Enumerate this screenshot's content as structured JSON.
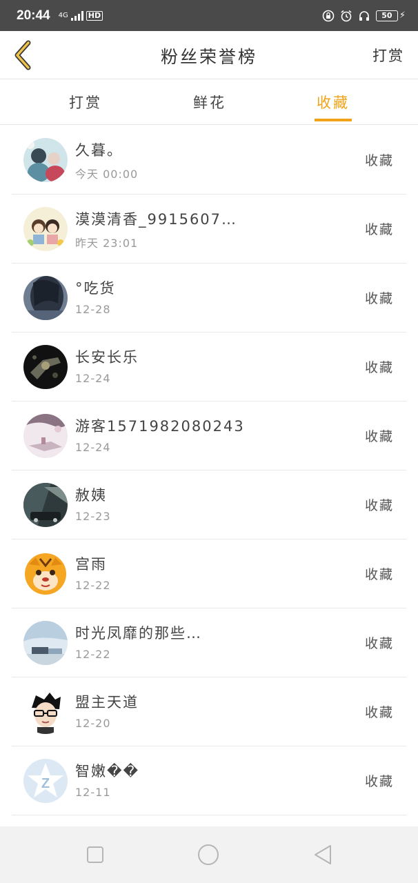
{
  "status_bar": {
    "time": "20:44",
    "network": "4G",
    "hd": "HD",
    "battery": "50",
    "icons": [
      "lock-rotation-icon",
      "alarm-icon",
      "headphones-icon",
      "battery-icon",
      "charging-bolt-icon"
    ]
  },
  "nav": {
    "back_icon": "chevron-left-icon",
    "title": "粉丝荣誉榜",
    "action": "打赏"
  },
  "tabs": [
    {
      "label": "打赏",
      "active": false
    },
    {
      "label": "鲜花",
      "active": false
    },
    {
      "label": "收藏",
      "active": true
    }
  ],
  "colors": {
    "accent": "#f0a318",
    "status_bar": "#4a4a4a",
    "divider": "#e8e8e8",
    "bottom_bar": "#f2f2f2"
  },
  "list": [
    {
      "name": "久暮。",
      "date": "今天 00:00",
      "tag": "收藏"
    },
    {
      "name": "漠漠清香_9915607…",
      "date": "昨天 23:01",
      "tag": "收藏"
    },
    {
      "name": "°吃货",
      "date": "12-28",
      "tag": "收藏"
    },
    {
      "name": "长安长乐",
      "date": "12-24",
      "tag": "收藏"
    },
    {
      "name": "游客1571982080243",
      "date": "12-24",
      "tag": "收藏"
    },
    {
      "name": "赦姨",
      "date": "12-23",
      "tag": "收藏"
    },
    {
      "name": "宫雨",
      "date": "12-22",
      "tag": "收藏"
    },
    {
      "name": "时光凤靡的那些…",
      "date": "12-22",
      "tag": "收藏"
    },
    {
      "name": "盟主天道",
      "date": "12-20",
      "tag": "收藏"
    },
    {
      "name": "智嫩��",
      "date": "12-11",
      "tag": "收藏"
    }
  ],
  "bottom_nav": [
    "recent-apps-icon",
    "home-icon",
    "back-triangle-icon"
  ]
}
